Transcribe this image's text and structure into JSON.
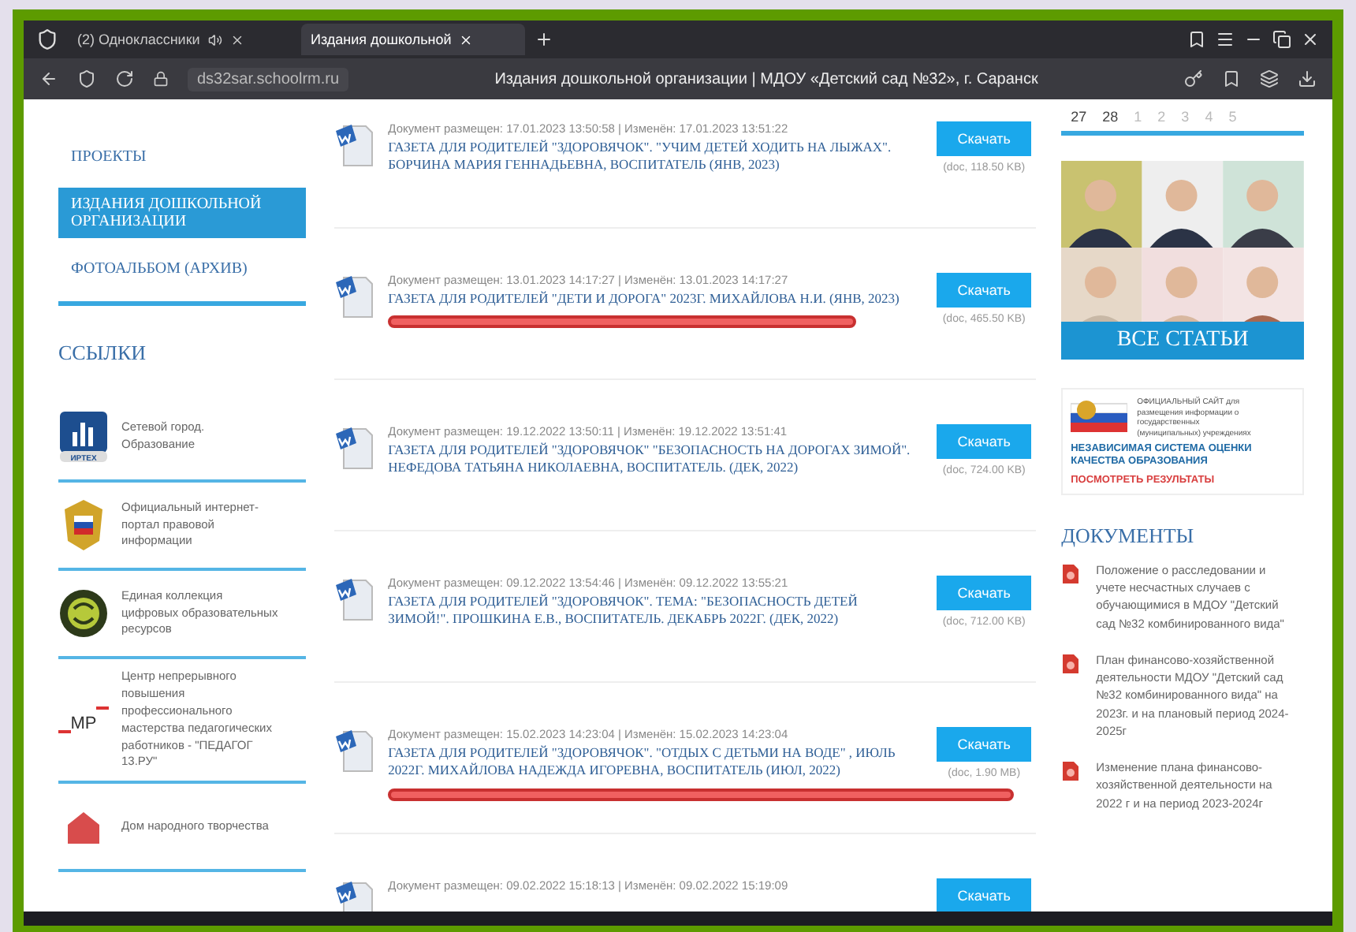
{
  "browser": {
    "tabs": [
      {
        "title": "(2) Одноклассники",
        "selected": false,
        "muted_icon": true
      },
      {
        "title": "Издания дошкольной",
        "selected": true,
        "muted_icon": false
      }
    ],
    "address": "ds32sar.schoolrm.ru",
    "page_title": "Издания дошкольной организации | МДОУ «Детский сад №32», г. Саранск"
  },
  "sidebar": {
    "menu": [
      {
        "label": "ПРОЕКТЫ",
        "selected": false
      },
      {
        "label": "ИЗДАНИЯ ДОШКОЛЬНОЙ ОРГАНИЗАЦИИ",
        "selected": true
      },
      {
        "label": "ФОТОАЛЬБОМ (АРХИВ)",
        "selected": false
      }
    ],
    "links_title": "ССЫЛКИ",
    "links": [
      {
        "kind": "irtech",
        "logo_text": "ИРТЕХ",
        "text": "Сетевой город. Образование"
      },
      {
        "kind": "emblem",
        "text": "Официальный интернет-портал правовой информации"
      },
      {
        "kind": "collection",
        "text": "Единая коллекция цифровых образовательных ресурсов"
      },
      {
        "kind": "mp",
        "logo_text": "MP",
        "text": "Центр непрерывного повышения профессионального мастерства педагогических работников - \"ПЕДАГОГ 13.РУ\""
      },
      {
        "kind": "house",
        "text": "Дом народного творчества"
      }
    ]
  },
  "documents": [
    {
      "meta": "Документ размещен: 17.01.2023 13:50:58 | Изменён: 17.01.2023 13:51:22",
      "title": "ГАЗЕТА ДЛЯ РОДИТЕЛЕЙ \"ЗДОРОВЯЧОК\". \"УЧИМ ДЕТЕЙ ХОДИТЬ НА ЛЫЖАХ\". БОРЧИНА МАРИЯ ГЕННАДЬЕВНА, ВОСПИТАТЕЛЬ (ЯНВ, 2023)",
      "button": "Скачать",
      "size": "(doc, 118.50 KB)",
      "underlined": false
    },
    {
      "meta": "Документ размещен: 13.01.2023 14:17:27 | Изменён: 13.01.2023 14:17:27",
      "title": "ГАЗЕТА ДЛЯ РОДИТЕЛЕЙ \"ДЕТИ И ДОРОГА\" 2023Г. МИХАЙЛОВА Н.И. (ЯНВ, 2023)",
      "button": "Скачать",
      "size": "(doc, 465.50 KB)",
      "underlined": true
    },
    {
      "meta": "Документ размещен: 19.12.2022 13:50:11 | Изменён: 19.12.2022 13:51:41",
      "title": "ГАЗЕТА ДЛЯ РОДИТЕЛЕЙ \"ЗДОРОВЯЧОК\" \"БЕЗОПАСНОСТЬ НА ДОРОГАХ ЗИМОЙ\". НЕФЕДОВА ТАТЬЯНА НИКОЛАЕВНА, ВОСПИТАТЕЛЬ. (ДЕК, 2022)",
      "button": "Скачать",
      "size": "(doc, 724.00 KB)",
      "underlined": false
    },
    {
      "meta": "Документ размещен: 09.12.2022 13:54:46 | Изменён: 09.12.2022 13:55:21",
      "title": "ГАЗЕТА ДЛЯ РОДИТЕЛЕЙ \"ЗДОРОВЯЧОК\". ТЕМА: \"БЕЗОПАСНОСТЬ ДЕТЕЙ ЗИМОЙ!\". ПРОШКИНА Е.В., ВОСПИТАТЕЛЬ. ДЕКАБРЬ 2022Г. (ДЕК, 2022)",
      "button": "Скачать",
      "size": "(doc, 712.00 KB)",
      "underlined": false
    },
    {
      "meta": "Документ размещен: 15.02.2023 14:23:04 | Изменён: 15.02.2023 14:23:04",
      "title": "ГАЗЕТА ДЛЯ РОДИТЕЛЕЙ \"ЗДОРОВЯЧОК\". \"ОТДЫХ С ДЕТЬМИ НА ВОДЕ\" , ИЮЛЬ 2022Г. МИХАЙЛОВА НАДЕЖДА ИГОРЕВНА, ВОСПИТАТЕЛЬ (ИЮЛ, 2022)",
      "button": "Скачать",
      "size": "(doc, 1.90 MB)",
      "underlined": true
    },
    {
      "meta": "Документ размещен: 09.02.2022 15:18:13 | Изменён: 09.02.2022 15:19:09",
      "button": "Скачать",
      "underlined": false
    }
  ],
  "right": {
    "calendar_days": [
      "27",
      "28",
      "1",
      "2",
      "3",
      "4",
      "5"
    ],
    "articles_button": "ВСЕ СТАТЬИ",
    "banner": {
      "small": "ОФИЦИАЛЬНЫЙ САЙТ для размещения информации о государственных (муниципальных) учреждениях",
      "title": "НЕЗАВИСИМАЯ СИСТЕМА ОЦЕНКИ КАЧЕСТВА ОБРАЗОВАНИЯ",
      "link": "ПОСМОТРЕТЬ РЕЗУЛЬТАТЫ"
    },
    "docs_title": "ДОКУМЕНТЫ",
    "docs": [
      "Положение о расследовании и учете несчастных случаев с обучающимися в МДОУ \"Детский сад №32 комбинированного вида\"",
      "План финансово-хозяйственной деятельности МДОУ \"Детский сад №32 комбинированного вида\" на 2023г. и на плановый период 2024-2025г",
      "Изменение плана финансово-хозяйственной деятельности на 2022 г и на период 2023-2024г"
    ]
  }
}
